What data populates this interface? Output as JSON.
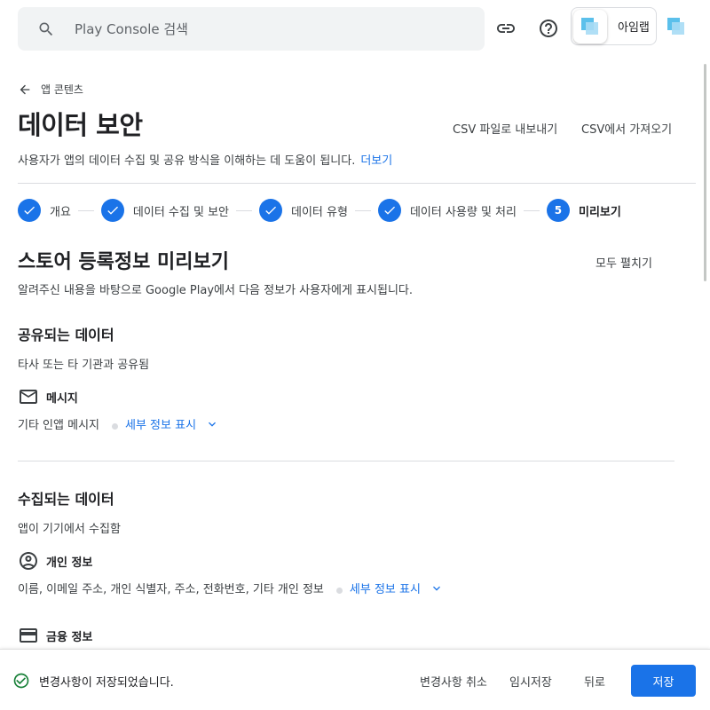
{
  "search": {
    "placeholder": "Play Console 검색"
  },
  "account": {
    "name": "아임랩"
  },
  "header": {
    "back_label": "앱 콘텐츠",
    "title": "데이터 보안",
    "export_csv": "CSV 파일로 내보내기",
    "import_csv": "CSV에서 가져오기",
    "description": "사용자가 앱의 데이터 수집 및 공유 방식을 이해하는 데 도움이 됩니다.",
    "learn_more": "더보기"
  },
  "stepper": {
    "steps": [
      {
        "label": "개요",
        "state": "done"
      },
      {
        "label": "데이터 수집 및 보안",
        "state": "done"
      },
      {
        "label": "데이터 유형",
        "state": "done"
      },
      {
        "label": "데이터 사용량 및 처리",
        "state": "done"
      },
      {
        "label": "미리보기",
        "state": "active",
        "number": "5"
      }
    ]
  },
  "preview": {
    "title": "스토어 등록정보 미리보기",
    "expand_all": "모두 펼치기",
    "description": "알려주신 내용을 바탕으로 Google Play에서 다음 정보가 사용자에게 표시됩니다.",
    "shared": {
      "title": "공유되는 데이터",
      "subtitle": "타사 또는 타 기관과 공유됨",
      "items": [
        {
          "icon": "mail-icon",
          "label": "메시지",
          "detail": "기타 인앱 메시지",
          "more": "세부 정보 표시"
        }
      ]
    },
    "collected": {
      "title": "수집되는 데이터",
      "subtitle": "앱이 기기에서 수집함",
      "items": [
        {
          "icon": "account-circle-icon",
          "label": "개인 정보",
          "detail": "이름, 이메일 주소, 개인 식별자, 주소, 전화번호, 기타 개인 정보",
          "more": "세부 정보 표시"
        },
        {
          "icon": "credit-card-icon",
          "label": "금융 정보"
        }
      ]
    }
  },
  "footer": {
    "saved_message": "변경사항이 저장되었습니다.",
    "discard": "변경사항 취소",
    "save_draft": "임시저장",
    "back": "뒤로",
    "save": "저장"
  },
  "colors": {
    "accent": "#1a73e8",
    "success": "#188038"
  }
}
